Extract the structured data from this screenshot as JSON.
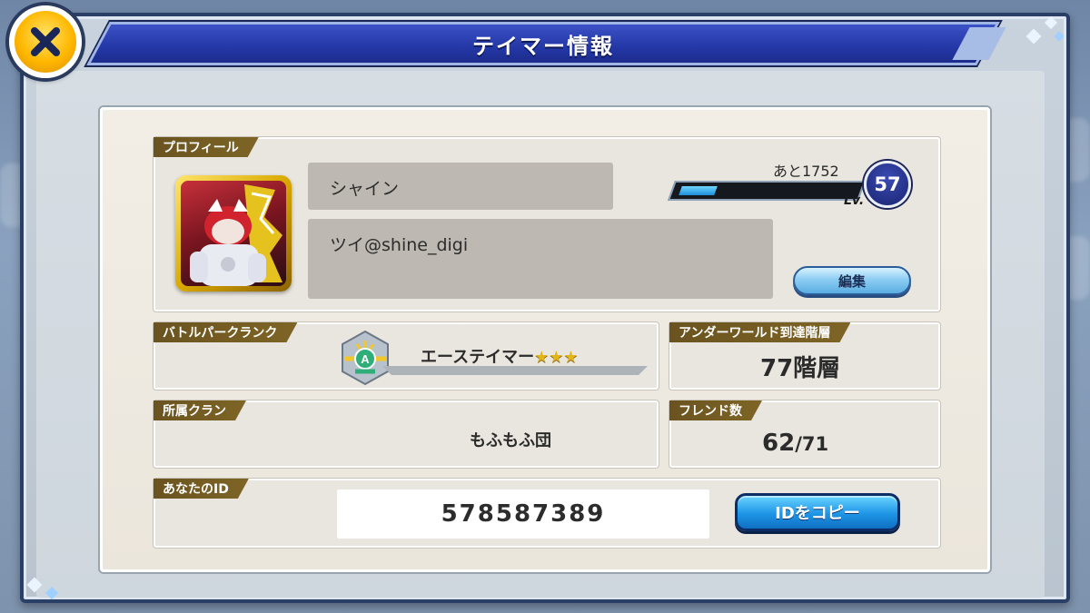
{
  "title": "テイマー情報",
  "profile": {
    "section_label": "プロフィール",
    "name": "シャイン",
    "comment": "ツイ@shine_digi",
    "remaining_exp_text": "あと1752",
    "level": "57",
    "level_label": "Lv.",
    "edit_label": "編集",
    "exp_progress": 0.2
  },
  "battle_park_rank": {
    "label": "バトルパークランク",
    "rank_name": "エーステイマー",
    "stars": "★★★"
  },
  "underworld": {
    "label": "アンダーワールド到達階層",
    "value": "77階層"
  },
  "clan": {
    "label": "所属クラン",
    "value": "もふもふ団"
  },
  "friends": {
    "label": "フレンド数",
    "current": "62",
    "max": "/71"
  },
  "your_id": {
    "label": "あなたのID",
    "value": "578587389",
    "copy_label": "IDをコピー"
  },
  "icons": {
    "close": "close-x-icon",
    "rank": "rank-emblem-icon"
  },
  "colors": {
    "title_bar": "#2437a6",
    "tag_bg": "#6a531f",
    "close_button": "#ffb700",
    "copy_button": "#1e95e6"
  }
}
